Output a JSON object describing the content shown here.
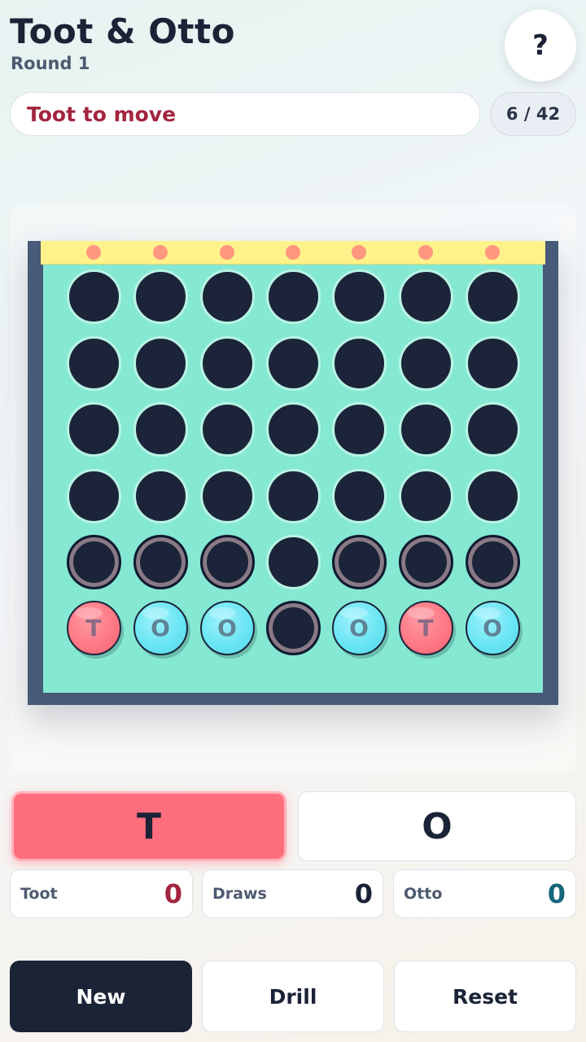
{
  "header": {
    "title": "Toot & Otto",
    "round_label": "Round 1",
    "help_label": "?"
  },
  "status": {
    "message": "Toot to move",
    "move_count": "6 / 42"
  },
  "board": {
    "columns": 7,
    "rows": 6,
    "bottom_row": [
      "T",
      "O",
      "O",
      "",
      "O",
      "T",
      "O"
    ],
    "hint_cells": [
      [
        4,
        0
      ],
      [
        4,
        1
      ],
      [
        4,
        2
      ],
      [
        4,
        4
      ],
      [
        4,
        5
      ],
      [
        4,
        6
      ],
      [
        5,
        3
      ]
    ]
  },
  "letter_picker": {
    "t_label": "T",
    "o_label": "O",
    "selected": "T"
  },
  "scores": {
    "toot_label": "Toot",
    "toot_value": "0",
    "draws_label": "Draws",
    "draws_value": "0",
    "otto_label": "Otto",
    "otto_value": "0"
  },
  "actions": {
    "new_label": "New",
    "drill_label": "Drill",
    "reset_label": "Reset"
  },
  "colors": {
    "toot_accent": "#a3243f",
    "otto_accent": "#13677a",
    "t_piece": "#fd7683",
    "o_piece": "#67e4f3",
    "board_bg": "#85e8d3",
    "frame": "#475a78"
  }
}
